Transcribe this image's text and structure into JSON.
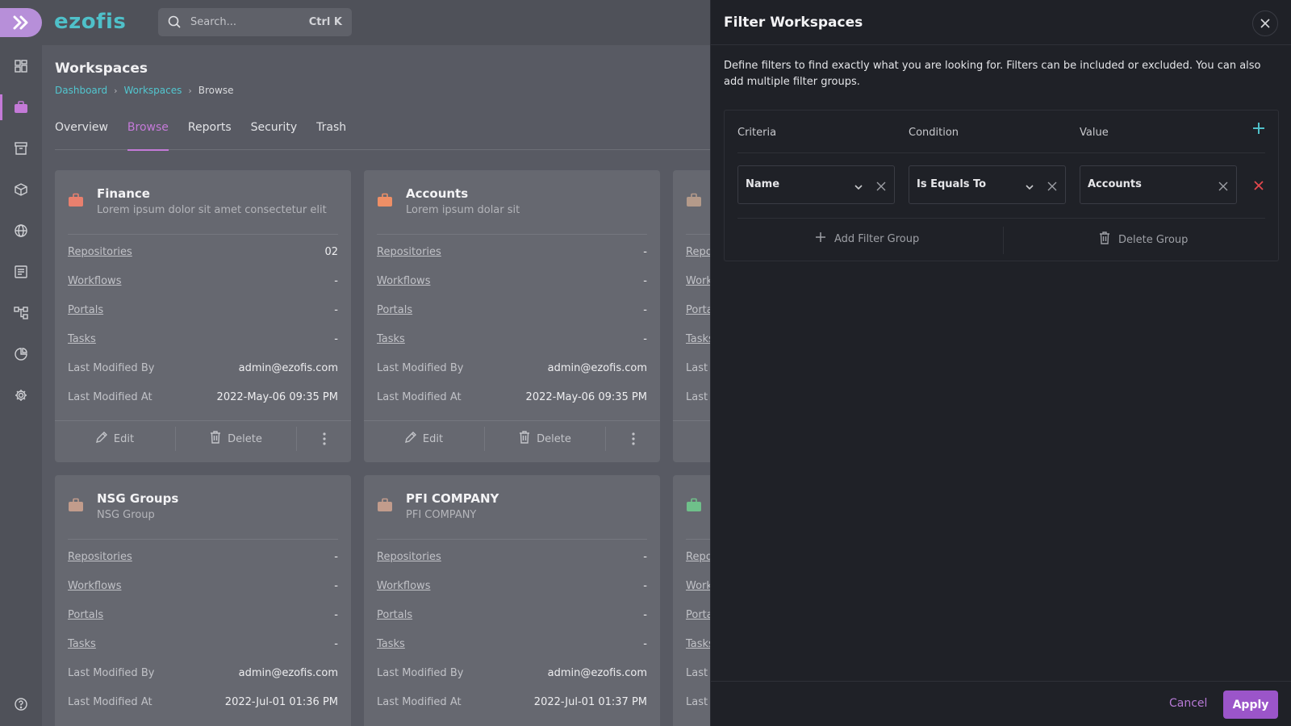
{
  "app": {
    "brand": "ezofis"
  },
  "search": {
    "placeholder": "Search...",
    "shortcut": "Ctrl K"
  },
  "sidebar": {
    "icons": [
      "dashboard-icon",
      "briefcase-icon",
      "archive-icon",
      "cube-icon",
      "globe-icon",
      "list-icon",
      "workflow-icon",
      "chart-icon",
      "gear-icon",
      "help-icon"
    ],
    "active": "briefcase-icon"
  },
  "page": {
    "title": "Workspaces",
    "breadcrumb": [
      "Dashboard",
      "Workspaces",
      "Browse"
    ],
    "tabs": [
      "Overview",
      "Browse",
      "Reports",
      "Security",
      "Trash"
    ],
    "active_tab": "Browse"
  },
  "cards": [
    {
      "title": "Finance",
      "subtitle": "Lorem ipsum dolor sit amet consectetur elit",
      "icon_color": "#e8806e",
      "rows": [
        {
          "label": "Repositories",
          "value": "02"
        },
        {
          "label": "Workflows",
          "value": "-"
        },
        {
          "label": "Portals",
          "value": "-"
        },
        {
          "label": "Tasks",
          "value": "-"
        },
        {
          "label": "Last Modified By",
          "value": "admin@ezofis.com"
        },
        {
          "label": "Last Modified At",
          "value": "2022-May-06 09:35 PM"
        }
      ]
    },
    {
      "title": "Accounts",
      "subtitle": "Lorem ipsum dolar sit",
      "icon_color": "#ee8f66",
      "rows": [
        {
          "label": "Repositories",
          "value": "-"
        },
        {
          "label": "Workflows",
          "value": "-"
        },
        {
          "label": "Portals",
          "value": "-"
        },
        {
          "label": "Tasks",
          "value": "-"
        },
        {
          "label": "Last Modified By",
          "value": "admin@ezofis.com"
        },
        {
          "label": "Last Modified At",
          "value": "2022-May-06 09:35 PM"
        }
      ]
    },
    {
      "title": "",
      "subtitle": "",
      "icon_color": "#b49a8a",
      "rows": [
        {
          "label": "Repo",
          "value": ""
        },
        {
          "label": "Work",
          "value": ""
        },
        {
          "label": "Porta",
          "value": ""
        },
        {
          "label": "Tasks",
          "value": ""
        },
        {
          "label": "Last",
          "value": ""
        },
        {
          "label": "Last",
          "value": ""
        }
      ]
    },
    {
      "title": "NSG Groups",
      "subtitle": "NSG Group",
      "icon_color": "#c29c8c",
      "rows": [
        {
          "label": "Repositories",
          "value": "-"
        },
        {
          "label": "Workflows",
          "value": "-"
        },
        {
          "label": "Portals",
          "value": "-"
        },
        {
          "label": "Tasks",
          "value": "-"
        },
        {
          "label": "Last Modified By",
          "value": "admin@ezofis.com"
        },
        {
          "label": "Last Modified At",
          "value": "2022-Jul-01 01:36 PM"
        }
      ]
    },
    {
      "title": "PFI COMPANY",
      "subtitle": "PFI COMPANY",
      "icon_color": "#c29c8c",
      "rows": [
        {
          "label": "Repositories",
          "value": "-"
        },
        {
          "label": "Workflows",
          "value": "-"
        },
        {
          "label": "Portals",
          "value": "-"
        },
        {
          "label": "Tasks",
          "value": "-"
        },
        {
          "label": "Last Modified By",
          "value": "admin@ezofis.com"
        },
        {
          "label": "Last Modified At",
          "value": "2022-Jul-01 01:37 PM"
        }
      ]
    },
    {
      "title": "",
      "subtitle": "",
      "icon_color": "#6fc08a",
      "rows": [
        {
          "label": "Repo",
          "value": ""
        },
        {
          "label": "Work",
          "value": ""
        },
        {
          "label": "Porta",
          "value": ""
        },
        {
          "label": "Tasks",
          "value": ""
        },
        {
          "label": "Last",
          "value": ""
        },
        {
          "label": "Last",
          "value": ""
        }
      ]
    }
  ],
  "card_actions": {
    "edit": "Edit",
    "delete": "Delete"
  },
  "filter": {
    "title": "Filter Workspaces",
    "description": "Define filters to find exactly what you are looking for. Filters can be included or excluded. You can also add multiple filter groups.",
    "headers": {
      "criteria": "Criteria",
      "condition": "Condition",
      "value": "Value"
    },
    "criteria_value": "Name",
    "condition_value": "Is Equals To",
    "value_value": "Accounts",
    "add_group": "Add Filter Group",
    "delete_group": "Delete Group",
    "cancel": "Cancel",
    "apply": "Apply"
  },
  "colors": {
    "accent": "#c47ad8",
    "brand": "#4fc0c9",
    "danger": "#e5484d",
    "apply_bg": "#9b55c9"
  }
}
